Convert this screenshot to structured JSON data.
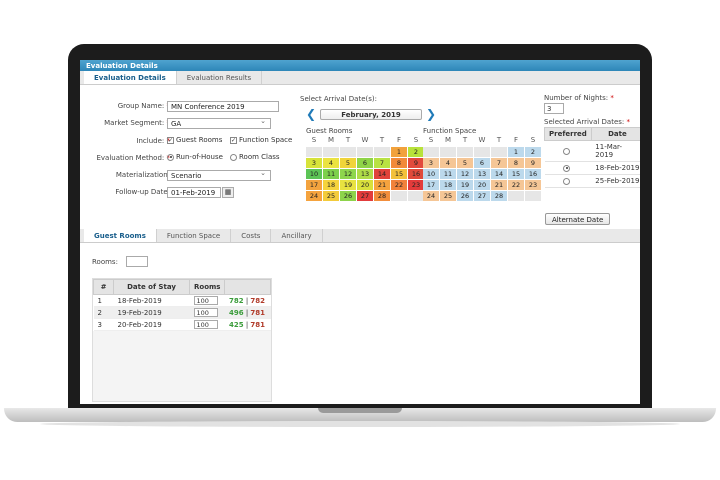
{
  "window": {
    "title": "Evaluation Details"
  },
  "top_tabs": [
    {
      "label": "Evaluation Details",
      "active": true
    },
    {
      "label": "Evaluation Results",
      "active": false
    }
  ],
  "form": {
    "group_name": {
      "label": "Group Name:",
      "required": "*",
      "value": "MN Conference 2019"
    },
    "market_segment": {
      "label": "Market Segment:",
      "required": "*",
      "value": "GA"
    },
    "include": {
      "label": "Include:",
      "required": "*",
      "options": [
        {
          "label": "Guest Rooms",
          "checked": true
        },
        {
          "label": "Function Space",
          "checked": true
        }
      ]
    },
    "evaluation_method": {
      "label": "Evaluation Method:",
      "required": "*",
      "options": [
        {
          "label": "Run-of-House",
          "selected": true
        },
        {
          "label": "Room Class",
          "selected": false
        }
      ]
    },
    "materialization": {
      "label": "Materialization:",
      "value": "Scenario"
    },
    "follow_up_date": {
      "label": "Follow-up Date:",
      "value": "01-Feb-2019"
    }
  },
  "arrival": {
    "label": "Select Arrival Date(s):",
    "month": "February, 2019",
    "day_headers": [
      "S",
      "M",
      "T",
      "W",
      "T",
      "F",
      "S"
    ],
    "guest_rooms_title": "Guest Rooms",
    "function_space_title": "Function Space",
    "guest_rooms": [
      [
        "",
        "",
        "",
        "",
        "",
        "1",
        "2"
      ],
      [
        "3",
        "4",
        "5",
        "6",
        "7",
        "8",
        "9"
      ],
      [
        "10",
        "11",
        "12",
        "13",
        "14",
        "15",
        "16"
      ],
      [
        "17",
        "18",
        "19",
        "20",
        "21",
        "22",
        "23"
      ],
      [
        "24",
        "25",
        "26",
        "27",
        "28",
        "",
        ""
      ]
    ],
    "guest_rooms_colors": [
      [
        "#e6e6e6",
        "#e6e6e6",
        "#e6e6e6",
        "#e6e6e6",
        "#e6e6e6",
        "#f2a23c",
        "#b8e23a"
      ],
      [
        "#d7e33a",
        "#ebe341",
        "#f0d43a",
        "#8fd447",
        "#b9e243",
        "#f28a3a",
        "#e24a3c"
      ],
      [
        "#5cc456",
        "#7dd04c",
        "#8ed64d",
        "#b0dc48",
        "#e0433a",
        "#f3c13a",
        "#e04a3a"
      ],
      [
        "#f3a33e",
        "#f5d33c",
        "#e8e240",
        "#d8e03c",
        "#f5a33e",
        "#f1823b",
        "#e33b3b"
      ],
      [
        "#f5a33e",
        "#f3cb3b",
        "#8dd34b",
        "#e23c3c",
        "#f28e3c",
        "#e6e6e6",
        "#e6e6e6"
      ]
    ],
    "function_space": [
      [
        "",
        "",
        "",
        "",
        "",
        "1",
        "2"
      ],
      [
        "3",
        "4",
        "5",
        "6",
        "7",
        "8",
        "9"
      ],
      [
        "10",
        "11",
        "12",
        "13",
        "14",
        "15",
        "16"
      ],
      [
        "17",
        "18",
        "19",
        "20",
        "21",
        "22",
        "23"
      ],
      [
        "24",
        "25",
        "26",
        "27",
        "28",
        "",
        ""
      ]
    ],
    "function_space_colors": [
      [
        "#e6e6e6",
        "#e6e6e6",
        "#e6e6e6",
        "#e6e6e6",
        "#e6e6e6",
        "#bcd9ec",
        "#bcd9ec"
      ],
      [
        "#f5c696",
        "#f5c696",
        "#f5c696",
        "#bcd9ec",
        "#f5c696",
        "#f5c696",
        "#f5c696"
      ],
      [
        "#bcd9ec",
        "#bcd9ec",
        "#bcd9ec",
        "#bcd9ec",
        "#bcd9ec",
        "#bcd9ec",
        "#bcd9ec"
      ],
      [
        "#bcd9ec",
        "#bcd9ec",
        "#bcd9ec",
        "#bcd9ec",
        "#f5c696",
        "#f5c696",
        "#f5c696"
      ],
      [
        "#f5c696",
        "#f5c696",
        "#bcd9ec",
        "#bcd9ec",
        "#bcd9ec",
        "#e6e6e6",
        "#e6e6e6"
      ]
    ]
  },
  "nights": {
    "label": "Number of Nights:",
    "required": "*",
    "value": "3"
  },
  "selected_dates": {
    "label": "Selected Arrival Dates:",
    "required": "*",
    "headers": [
      "Preferred",
      "Date"
    ],
    "rows": [
      {
        "preferred": false,
        "date": "11-Mar-2019"
      },
      {
        "preferred": true,
        "date": "18-Feb-2019"
      },
      {
        "preferred": false,
        "date": "25-Feb-2019"
      }
    ],
    "alternate_button": "Alternate Date"
  },
  "bottom_tabs": [
    {
      "label": "Guest Rooms",
      "active": true
    },
    {
      "label": "Function Space",
      "active": false
    },
    {
      "label": "Costs",
      "active": false
    },
    {
      "label": "Ancillary",
      "active": false
    }
  ],
  "rooms": {
    "label": "Rooms:",
    "value": "",
    "headers": [
      "#",
      "Date of Stay",
      "Rooms",
      ""
    ],
    "rows": [
      {
        "num": "1",
        "date": "18-Feb-2019",
        "rooms": "100",
        "a": "782",
        "sep": "|",
        "b": "782"
      },
      {
        "num": "2",
        "date": "19-Feb-2019",
        "rooms": "100",
        "a": "496",
        "sep": "|",
        "b": "781"
      },
      {
        "num": "3",
        "date": "20-Feb-2019",
        "rooms": "100",
        "a": "425",
        "sep": "|",
        "b": "781"
      }
    ]
  }
}
